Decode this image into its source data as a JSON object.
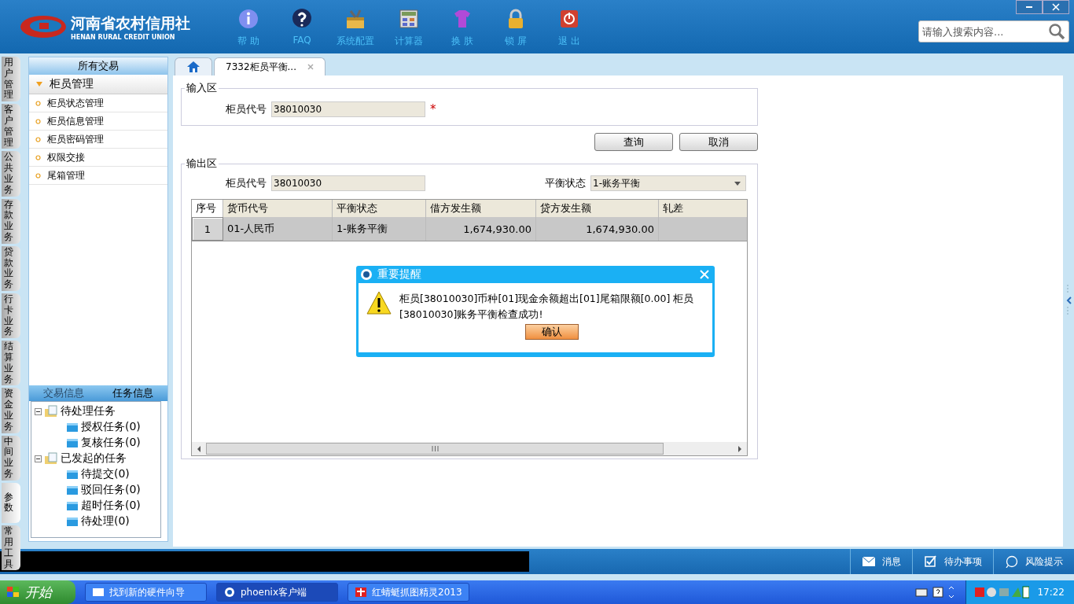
{
  "header": {
    "logo_title": "河南省农村信用社",
    "logo_subtitle": "HENAN RURAL CREDIT UNION",
    "toolbar": [
      {
        "label": "帮 助",
        "kind": "info"
      },
      {
        "label": "FAQ",
        "kind": "faq"
      },
      {
        "label": "系统配置",
        "kind": "toolbox"
      },
      {
        "label": "计算器",
        "kind": "calc"
      },
      {
        "label": "换 肤",
        "kind": "shirt"
      },
      {
        "label": "锁 屏",
        "kind": "lock"
      },
      {
        "label": "退 出",
        "kind": "power"
      }
    ],
    "search": {
      "placeholder": "请输入搜索内容..."
    }
  },
  "side_tabs": [
    {
      "label": "用户管理",
      "selected": false
    },
    {
      "label": "客户管理",
      "selected": false
    },
    {
      "label": "公共业务",
      "selected": false
    },
    {
      "label": "存款业务",
      "selected": false
    },
    {
      "label": "贷款业务",
      "selected": false
    },
    {
      "label": "行卡业务",
      "selected": false
    },
    {
      "label": "结算业务",
      "selected": false
    },
    {
      "label": "资金业务",
      "selected": false
    },
    {
      "label": "中间业务",
      "selected": false
    },
    {
      "label": "参数",
      "selected": true
    },
    {
      "label": "常用工具",
      "selected": false
    }
  ],
  "sidebar": {
    "title": "所有交易",
    "group": {
      "label": "柜员管理",
      "expanded": true,
      "items": [
        "柜员状态管理",
        "柜员信息管理",
        "柜员密码管理",
        "权限交接",
        "尾箱管理"
      ]
    },
    "bottom_tabs": [
      {
        "label": "交易信息",
        "selected": false
      },
      {
        "label": "任务信息",
        "selected": true
      }
    ],
    "tree": [
      {
        "label": "待处理任务",
        "expanded": true,
        "children": [
          {
            "label": "授权任务(0)"
          },
          {
            "label": "复核任务(0)"
          }
        ]
      },
      {
        "label": "已发起的任务",
        "expanded": true,
        "children": [
          {
            "label": "待提交(0)"
          },
          {
            "label": "驳回任务(0)"
          },
          {
            "label": "超时任务(0)"
          },
          {
            "label": "待处理(0)"
          }
        ]
      }
    ]
  },
  "tabs": [
    {
      "kind": "home",
      "selected": false
    },
    {
      "kind": "page",
      "label": "7332柜员平衡...",
      "selected": true
    }
  ],
  "input_area": {
    "title": "输入区",
    "field_label": "柜员代号",
    "field_value": "38010030",
    "required_mark": "*"
  },
  "buttons": [
    "查询",
    "取消"
  ],
  "output_area": {
    "title": "输出区",
    "teller_label": "柜员代号",
    "teller_value": "38010030",
    "status_label": "平衡状态",
    "status_value": "1-账务平衡",
    "table": {
      "columns": [
        "序号",
        "货币代号",
        "平衡状态",
        "借方发生额",
        "贷方发生额",
        "轧差"
      ],
      "rows": [
        {
          "selected": true,
          "cells": [
            "1",
            "01-人民币",
            "1-账务平衡",
            "1,674,930.00",
            "1,674,930.00",
            ""
          ]
        }
      ]
    }
  },
  "dialog": {
    "title": "重要提醒",
    "message": "柜员[38010030]币种[01]现金余额超出[01]尾箱限额[0.00] 柜员[38010030]账务平衡检查成功!",
    "button": "确认"
  },
  "status_bar": [
    {
      "label": "消息",
      "kind": "mail"
    },
    {
      "label": "待办事项",
      "kind": "check"
    },
    {
      "label": "风险提示",
      "kind": "bubble"
    }
  ],
  "taskbar": {
    "start": "开始",
    "tasks": [
      {
        "label": "找到新的硬件向导",
        "selected": false,
        "kind": "window"
      },
      {
        "label": "phoenix客户端",
        "selected": true,
        "kind": "ie"
      },
      {
        "label": "红蜻蜓抓图精灵2013",
        "selected": false,
        "kind": "red"
      }
    ],
    "time": "17:22"
  }
}
